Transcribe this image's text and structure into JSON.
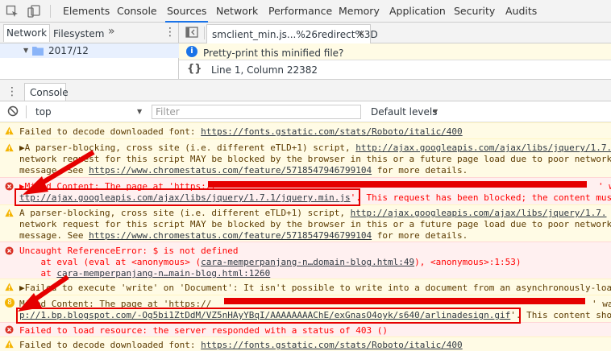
{
  "toolbar": {
    "tabs": [
      "Elements",
      "Console",
      "Sources",
      "Network",
      "Performance",
      "Memory",
      "Application",
      "Security",
      "Audits"
    ],
    "active_tab": "Sources"
  },
  "sources": {
    "nav_tabs": [
      "Network",
      "Filesystem"
    ],
    "more_glyph": "»",
    "more_vert": "⋮",
    "tree_folder": "2017/12",
    "file_tab": "smclient_min.js...%26redirect%3D",
    "pretty_print_prompt": "Pretty-print this minified file?",
    "braces": "{}",
    "position": "Line 1, Column 22382"
  },
  "drawer": {
    "tab": "Console",
    "context": "top",
    "filter_placeholder": "Filter",
    "levels": "Default levels"
  },
  "messages": [
    {
      "level": "warning",
      "lines": [
        [
          "Failed to decode downloaded font: ",
          "https://fonts.gstatic.com/stats/Roboto/italic/400",
          ""
        ]
      ]
    },
    {
      "level": "warning",
      "collapsed": true,
      "lines": [
        [
          "A parser-blocking, cross site (i.e. different eTLD+1) script, ",
          "http://ajax.googleapis.com/ajax/libs/jquery/1.7.",
          ""
        ],
        [
          "network request for this script MAY be blocked by the browser in this or a future page load due to poor network",
          "",
          " "
        ],
        [
          "message. See ",
          "https://www.chromestatus.com/feature/5718547946799104",
          " for more details."
        ]
      ]
    },
    {
      "level": "error",
      "collapsed": true,
      "lines": [
        [
          "Mixed Content: The page at 'https://",
          "",
          "' was"
        ],
        [
          "",
          "ttp://ajax.googleapis.com/ajax/libs/jquery/1.7.1/jquery.min.js",
          "'. This request has been blocked; the content must"
        ]
      ]
    },
    {
      "level": "warning",
      "lines": [
        [
          "A parser-blocking, cross site (i.e. different eTLD+1) script, ",
          "http://ajax.googleapis.com/ajax/libs/jquery/1.7.",
          ""
        ],
        [
          "network request for this script MAY be blocked by the browser in this or a future page load due to poor network",
          "",
          " "
        ],
        [
          "message. See ",
          "https://www.chromestatus.com/feature/5718547946799104",
          " for more details."
        ]
      ]
    },
    {
      "level": "error",
      "lines": [
        [
          "Uncaught ReferenceError: $ is not defined",
          "",
          ""
        ],
        [
          "    at eval (eval at <anonymous> (",
          "cara-memperpanjang-n…domain-blog.html:49",
          "), <anonymous>:1:53)"
        ],
        [
          "    at ",
          "cara-memperpanjang-n…main-blog.html:1260",
          ""
        ]
      ]
    },
    {
      "level": "warning",
      "collapsed": true,
      "lines": [
        [
          "Failed to execute 'write' on 'Document': It isn't possible to write into a document from an asynchronously-loa",
          "",
          ""
        ]
      ]
    },
    {
      "level": "warning",
      "count": "8",
      "lines": [
        [
          "Mixed Content: The page at 'https://",
          "",
          "' was"
        ],
        [
          "",
          "p://1.bp.blogspot.com/-Og5bi1ZtDdM/VZ5nHAyYBqI/AAAAAAAAChE/exGnasO4oyk/s640/arlinadesign.gif",
          "'. This content sho"
        ]
      ]
    },
    {
      "level": "error",
      "lines": [
        [
          "Failed to load resource: the server responded with a status of 403 ()",
          "",
          ""
        ]
      ]
    },
    {
      "level": "warning",
      "lines": [
        [
          "Failed to decode downloaded font: ",
          "https://fonts.gstatic.com/stats/Roboto/italic/400",
          ""
        ]
      ]
    }
  ],
  "annotations": {
    "highlight_color": "#e50000"
  },
  "colors": {
    "accent": "#1a73e8",
    "warning_bg": "#fffbe5",
    "error_bg": "#fff0f0",
    "error_text": "#ff0000",
    "warning_icon": "#f4b400",
    "error_icon": "#d93025"
  }
}
